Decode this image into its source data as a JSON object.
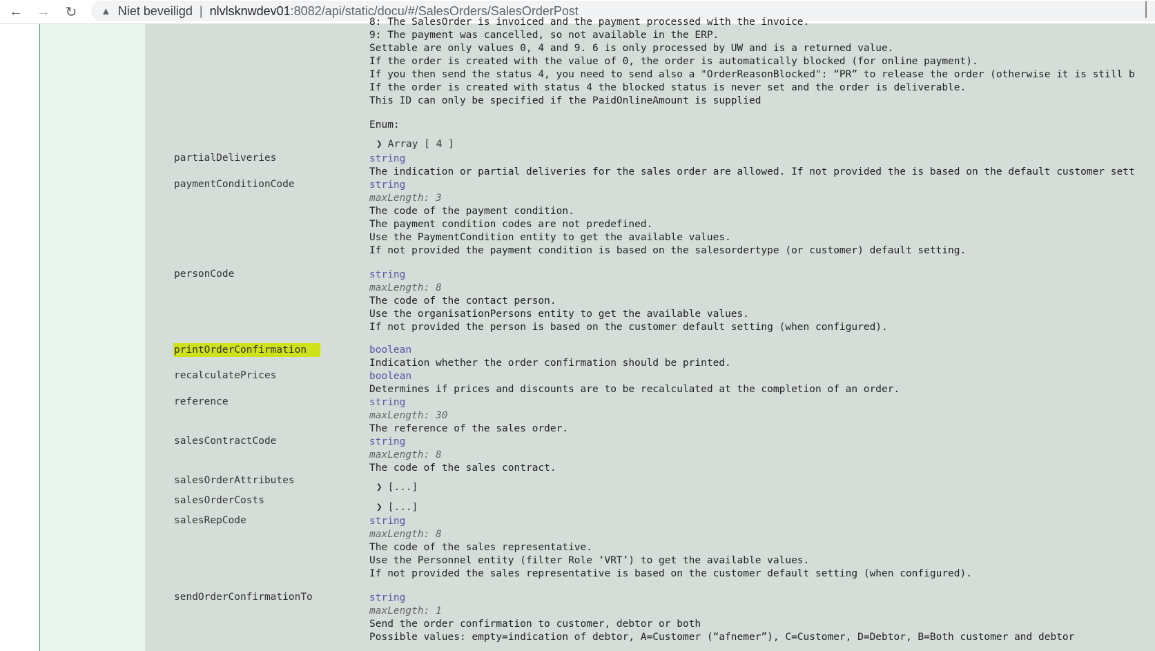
{
  "browser": {
    "back_icon": "arrow-left-icon",
    "forward_icon": "arrow-right-icon",
    "reload_icon": "reload-icon",
    "warning_icon": "warning-triangle-icon",
    "security_label": "Niet beveiligd",
    "separator": "|",
    "url_host": "nlvlsknwdev01",
    "url_path": ":8082/api/static/docu/#/SalesOrders/SalesOrderPost"
  },
  "top_block": {
    "lines": [
      "8: The SalesOrder is invoiced and the payment processed with the invoice.",
      "9: The payment was cancelled, so not available in the ERP.",
      "Settable are only values 0, 4 and 9. 6 is only processed by UW and is a returned value.",
      "If the order is created with the value of 0, the order is automatically blocked (for online payment).",
      "If you then send the status 4, you need to send also a \"OrderReasonBlocked\": “PR” to release the order (otherwise it is still b",
      "If the order is created with status 4 the blocked status is never set and the order is deliverable.",
      "This ID can only be specified if the PaidOnlineAmount is supplied"
    ],
    "enum_label": "Enum:",
    "enum_array": "Array [ 4 ]"
  },
  "properties": [
    {
      "name": "partialDeliveries",
      "type": "string",
      "maxlength": "",
      "desc": [
        "The indication or partial deliveries for the sales order are allowed. If not provided the is based on the default customer sett"
      ]
    },
    {
      "name": "paymentConditionCode",
      "type": "string",
      "maxlength": "maxLength: 3",
      "desc": [
        "The code of the payment condition.",
        "The payment condition codes are not predefined.",
        "Use the PaymentCondition entity to get the available values.",
        "If not provided the payment condition is based on the salesordertype (or customer) default setting."
      ]
    },
    {
      "name": "personCode",
      "type": "string",
      "maxlength": "maxLength: 8",
      "desc": [
        "The code of the contact person.",
        "Use the organisationPersons entity to get the available values.",
        "If not provided the person is based on the customer default setting (when configured)."
      ]
    },
    {
      "name": "printOrderConfirmation",
      "type": "boolean",
      "maxlength": "",
      "desc": [
        "Indication whether the order confirmation should be printed."
      ]
    },
    {
      "name": "recalculatePrices",
      "type": "boolean",
      "maxlength": "",
      "desc": [
        "Determines if prices and discounts are to be recalculated at the completion of an order."
      ]
    },
    {
      "name": "reference",
      "type": "string",
      "maxlength": "maxLength: 30",
      "desc": [
        "The reference of the sales order."
      ]
    },
    {
      "name": "salesContractCode",
      "type": "string",
      "maxlength": "maxLength: 8",
      "desc": [
        "The code of the sales contract."
      ]
    },
    {
      "name": "salesOrderAttributes",
      "expander": "[...]"
    },
    {
      "name": "salesOrderCosts",
      "expander": "[...]"
    },
    {
      "name": "salesRepCode",
      "type": "string",
      "maxlength": "maxLength: 8",
      "desc": [
        "The code of the sales representative.",
        "Use the Personnel entity (filter Role ‘VRT’) to get the available values.",
        "If not provided the sales representative is based on the customer default setting (when configured)."
      ]
    },
    {
      "name": "sendOrderConfirmationTo",
      "type": "string",
      "maxlength": "maxLength: 1",
      "desc": [
        "Send the order confirmation to customer, debtor or both",
        "Possible values: empty=indication of debtor, A=Customer (“afnemer”), C=Customer, D=Debtor, B=Both customer and debtor"
      ]
    }
  ],
  "highlight_color": "#cfe11a",
  "type_color": "#5555aa"
}
